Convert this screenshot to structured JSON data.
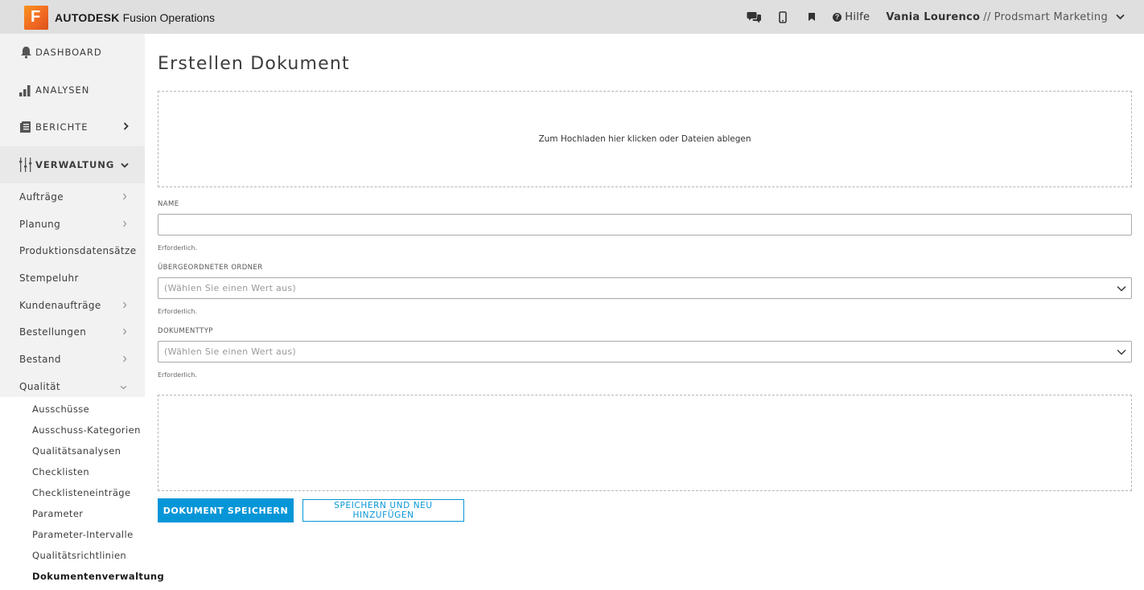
{
  "app": {
    "logo_letter": "F",
    "brand": "AUTODESK",
    "product": "Fusion Operations"
  },
  "topbar": {
    "icons": [
      "chat-icon",
      "mobile-icon",
      "bookmark-icon"
    ],
    "help_label": "Hilfe",
    "user_name": "Vania Lourenco",
    "separator": "//",
    "organization": "Prodsmart Marketing"
  },
  "sidebar": {
    "main_items": [
      {
        "label": "DASHBOARD",
        "icon": "bell-icon"
      },
      {
        "label": "ANALYSEN",
        "icon": "bar-chart-icon"
      },
      {
        "label": "BERICHTE",
        "icon": "report-icon"
      },
      {
        "label": "VERWALTUNG",
        "icon": "sliders-icon"
      }
    ],
    "sub_items": [
      {
        "label": "Aufträge"
      },
      {
        "label": "Planung"
      },
      {
        "label": "Produktionsdatensätze"
      },
      {
        "label": "Stempeluhr"
      },
      {
        "label": "Kundenaufträge"
      },
      {
        "label": "Bestellungen"
      },
      {
        "label": "Bestand"
      },
      {
        "label": "Qualität"
      }
    ],
    "quality_children": [
      {
        "label": "Ausschüsse"
      },
      {
        "label": "Ausschuss-Kategorien"
      },
      {
        "label": "Qualitätsanalysen"
      },
      {
        "label": "Checklisten"
      },
      {
        "label": "Checklisteneinträge"
      },
      {
        "label": "Parameter"
      },
      {
        "label": "Parameter-Intervalle"
      },
      {
        "label": "Qualitätsrichtlinien"
      },
      {
        "label": "Dokumentenverwaltung"
      }
    ]
  },
  "main": {
    "title": "Erstellen Dokument",
    "upload_text": "Zum Hochladen hier klicken oder Dateien ablegen",
    "fields": {
      "name_label": "NAME",
      "name_value": "",
      "name_hint": "Erforderlich.",
      "parent_label": "ÜBERGEORDNETER ORDNER",
      "parent_placeholder": "(Wählen Sie einen Wert aus)",
      "parent_hint": "Erforderlich.",
      "type_label": "DOKUMENTTYP",
      "type_placeholder": "(Wählen Sie einen Wert aus)",
      "type_hint": "Erforderlich."
    },
    "buttons": {
      "save": "DOKUMENT SPEICHERN",
      "save_and_new": "SPEICHERN UND NEU HINZUFÜGEN"
    }
  },
  "colors": {
    "accent": "#0696d7",
    "logo_orange": "#f26a22",
    "topbar_bg": "#dfdfdf",
    "sidebar_bg": "#f2f2f2"
  }
}
